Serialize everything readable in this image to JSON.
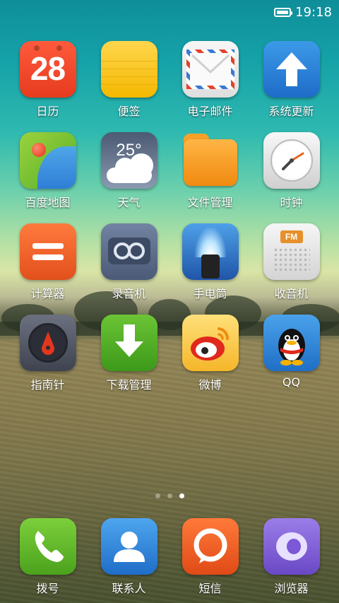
{
  "status_bar": {
    "time": "19:18",
    "battery_level": 1.0
  },
  "apps": [
    {
      "label": "日历",
      "icon": "calendar-icon",
      "date_number": "28"
    },
    {
      "label": "便签",
      "icon": "notes-icon"
    },
    {
      "label": "电子邮件",
      "icon": "email-envelope-icon"
    },
    {
      "label": "系统更新",
      "icon": "update-arrow-icon"
    },
    {
      "label": "百度地图",
      "icon": "map-pin-icon"
    },
    {
      "label": "天气",
      "icon": "weather-cloud-icon",
      "temperature": "25°"
    },
    {
      "label": "文件管理",
      "icon": "folder-icon"
    },
    {
      "label": "时钟",
      "icon": "clock-icon"
    },
    {
      "label": "计算器",
      "icon": "calculator-icon"
    },
    {
      "label": "录音机",
      "icon": "cassette-tape-icon"
    },
    {
      "label": "手电筒",
      "icon": "flashlight-icon"
    },
    {
      "label": "收音机",
      "icon": "radio-icon",
      "badge": "FM"
    },
    {
      "label": "指南针",
      "icon": "compass-icon"
    },
    {
      "label": "下载管理",
      "icon": "download-arrow-icon"
    },
    {
      "label": "微博",
      "icon": "weibo-eye-icon"
    },
    {
      "label": "QQ",
      "icon": "qq-penguin-icon"
    }
  ],
  "pager": {
    "page_count": 3,
    "active_page": 3
  },
  "dock": [
    {
      "label": "拨号",
      "icon": "phone-handset-icon"
    },
    {
      "label": "联系人",
      "icon": "contact-person-icon"
    },
    {
      "label": "短信",
      "icon": "message-bubble-icon"
    },
    {
      "label": "浏览器",
      "icon": "browser-ring-icon"
    }
  ]
}
